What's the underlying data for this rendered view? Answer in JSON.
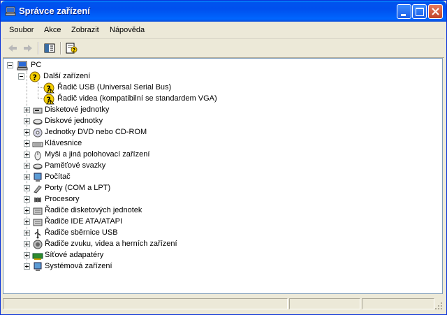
{
  "window": {
    "title": "Správce zařízení"
  },
  "menu": [
    "Soubor",
    "Akce",
    "Zobrazit",
    "Nápověda"
  ],
  "tree": {
    "root": "PC",
    "other_devices": {
      "label": "Další zařízení",
      "children": [
        "Řadič USB (Universal Serial Bus)",
        "Řadič videa (kompatibilní se standardem VGA)"
      ]
    },
    "categories": [
      {
        "label": "Disketové jednotky",
        "icon": "floppy-drive-icon"
      },
      {
        "label": "Diskové jednotky",
        "icon": "disk-drive-icon"
      },
      {
        "label": "Jednotky DVD nebo CD-ROM",
        "icon": "dvd-drive-icon"
      },
      {
        "label": "Klávesnice",
        "icon": "keyboard-icon"
      },
      {
        "label": "Myši a jiná polohovací zařízení",
        "icon": "mouse-icon"
      },
      {
        "label": "Paměťové svazky",
        "icon": "storage-volume-icon"
      },
      {
        "label": "Počítač",
        "icon": "computer-icon"
      },
      {
        "label": "Porty (COM a LPT)",
        "icon": "port-icon"
      },
      {
        "label": "Procesory",
        "icon": "processor-icon"
      },
      {
        "label": "Řadiče disketových jednotek",
        "icon": "floppy-controller-icon"
      },
      {
        "label": "Řadiče IDE ATA/ATAPI",
        "icon": "ide-controller-icon"
      },
      {
        "label": "Řadiče sběrnice USB",
        "icon": "usb-icon"
      },
      {
        "label": "Řadiče zvuku, videa a herních zařízení",
        "icon": "sound-icon"
      },
      {
        "label": "Síťové adapatéry",
        "icon": "network-adapter-icon"
      },
      {
        "label": "Systémová zařízení",
        "icon": "system-device-icon"
      }
    ]
  },
  "colors": {
    "titlebar": "#0054e3",
    "window_bg": "#ece9d8",
    "warning": "#f5d000"
  }
}
